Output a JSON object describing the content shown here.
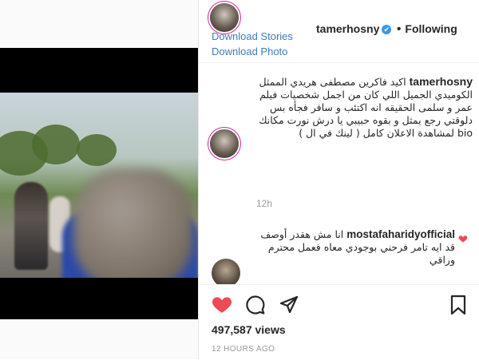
{
  "post": {
    "username": "tamerhosny",
    "follow_status": "Following",
    "verified_mark": "✔"
  },
  "downloader": {
    "stories_label": "Download Stories",
    "photo_label": "Download Photo"
  },
  "caption": {
    "username": "tamerhosny",
    "text": "اكيد فاكرين مصطفى هريدي الممثل الكوميدي الجميل اللي كان من اجمل شخصيات فيلم عمر و سلمى الحقيقه انه اكتئب و سافر فجأه بس دلوقتي رجع يمثل و بقوه حبيبي يا درش نورت مكانك bio لمشاهدة الاعلان كامل ( لينك في ال )",
    "time": "12h"
  },
  "comment": {
    "username": "mostafaharidyofficial",
    "text": "انا مش هقدر أوصف قد ايه تامر فرحني بوجودي معاه فعمل محترم وراقي"
  },
  "stats": {
    "views": "497,587 views",
    "posted_ago": "12 HOURS AGO"
  },
  "icons": {
    "like": "heart-icon",
    "comment": "comment-icon",
    "share": "share-icon",
    "save": "bookmark-icon"
  },
  "colors": {
    "like_red": "#ed4956",
    "verified_blue": "#3897f0",
    "link_blue": "#3b7dbf"
  }
}
